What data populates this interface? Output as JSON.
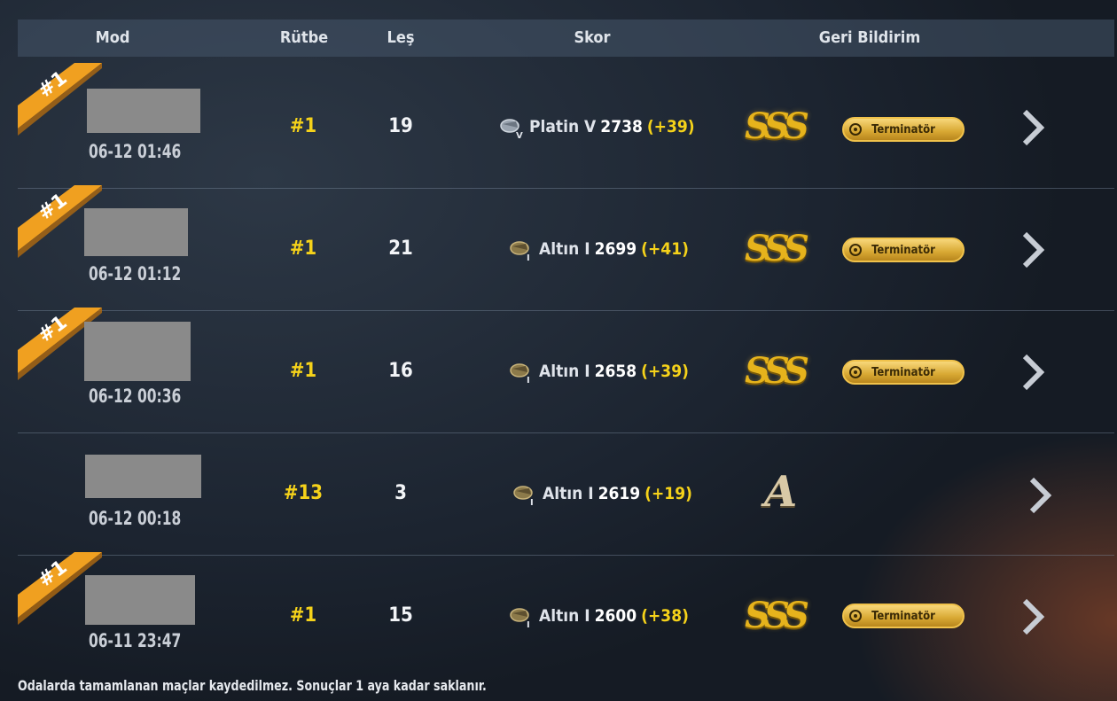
{
  "header": {
    "mod": "Mod",
    "rutbe": "Rütbe",
    "les": "Leş",
    "skor": "Skor",
    "geri_bildirim": "Geri Bildirim"
  },
  "rows": [
    {
      "badge": "#1",
      "date": "06-12 01:46",
      "rutbe": "#1",
      "les": "19",
      "tier": "Platin V",
      "tier_icon": "platinum-tier-icon",
      "score": "2738",
      "delta": "(+39)",
      "grade": "SSS",
      "title": "Terminatör"
    },
    {
      "badge": "#1",
      "date": "06-12 01:12",
      "rutbe": "#1",
      "les": "21",
      "tier": "Altın I",
      "tier_icon": "gold-tier-icon",
      "score": "2699",
      "delta": "(+41)",
      "grade": "SSS",
      "title": "Terminatör"
    },
    {
      "badge": "#1",
      "date": "06-12 00:36",
      "rutbe": "#1",
      "les": "16",
      "tier": "Altın I",
      "tier_icon": "gold-tier-icon",
      "score": "2658",
      "delta": "(+39)",
      "grade": "SSS",
      "title": "Terminatör"
    },
    {
      "badge": "",
      "date": "06-12 00:18",
      "rutbe": "#13",
      "les": "3",
      "tier": "Altın I",
      "tier_icon": "gold-tier-icon",
      "score": "2619",
      "delta": "(+19)",
      "grade": "A",
      "title": ""
    },
    {
      "badge": "#1",
      "date": "06-11 23:47",
      "rutbe": "#1",
      "les": "15",
      "tier": "Altın I",
      "tier_icon": "gold-tier-icon",
      "score": "2600",
      "delta": "(+38)",
      "grade": "SSS",
      "title": "Terminatör"
    }
  ],
  "footer": {
    "note": "Odalarda tamamlanan maçlar kaydedilmez. Sonuçlar 1 aya kadar saklanır."
  },
  "colors": {
    "accent_yellow": "#f5d21a",
    "badge_orange": "#f0a020",
    "grade_gold": "#e6b31c"
  }
}
